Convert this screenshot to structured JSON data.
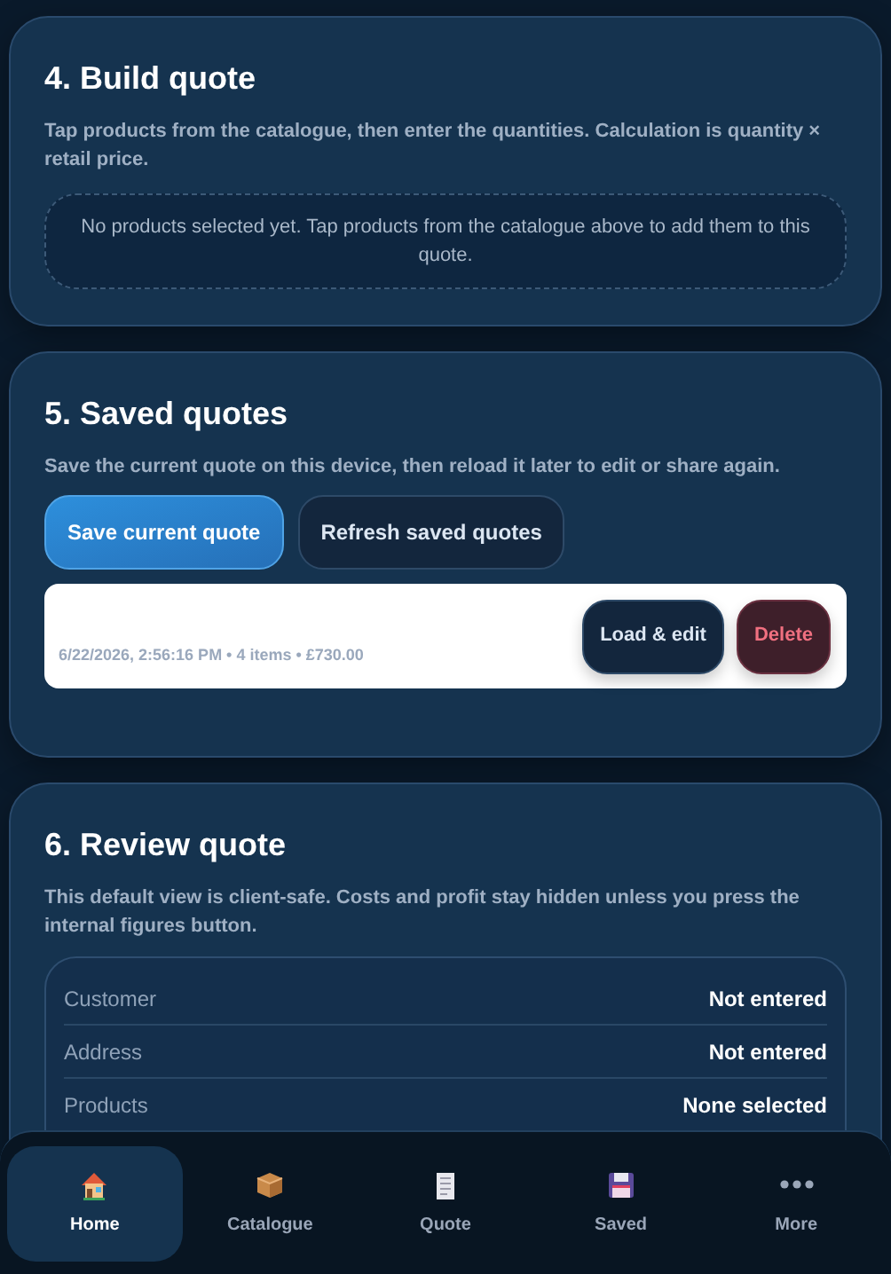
{
  "build": {
    "title": "4. Build quote",
    "description": "Tap products from the catalogue, then enter the quantities. Calculation is quantity × retail price.",
    "empty_message": "No products selected yet. Tap products from the catalogue above to add them to this quote."
  },
  "saved": {
    "title": "5. Saved quotes",
    "description": "Save the current quote on this device, then reload it later to edit or share again.",
    "buttons": [
      {
        "label": "Save current quote",
        "kind": "primary"
      },
      {
        "label": "Refresh saved quotes",
        "kind": "secondary"
      }
    ],
    "quotes": [
      {
        "meta": "6/22/2026, 2:56:16 PM • 4 items • £730.00",
        "load_label": "Load & edit",
        "delete_label": "Delete"
      }
    ]
  },
  "review": {
    "title": "6. Review quote",
    "description": "This default view is client-safe. Costs and profit stay hidden unless you press the internal figures button.",
    "rows": [
      {
        "label": "Customer",
        "value": "Not entered"
      },
      {
        "label": "Address",
        "value": "Not entered"
      },
      {
        "label": "Products",
        "value": "None selected"
      }
    ]
  },
  "nav": [
    {
      "label": "Home",
      "selected": true
    },
    {
      "label": "Catalogue",
      "selected": false
    },
    {
      "label": "Quote",
      "selected": false
    },
    {
      "label": "Saved",
      "selected": false
    },
    {
      "label": "More",
      "selected": false
    }
  ]
}
